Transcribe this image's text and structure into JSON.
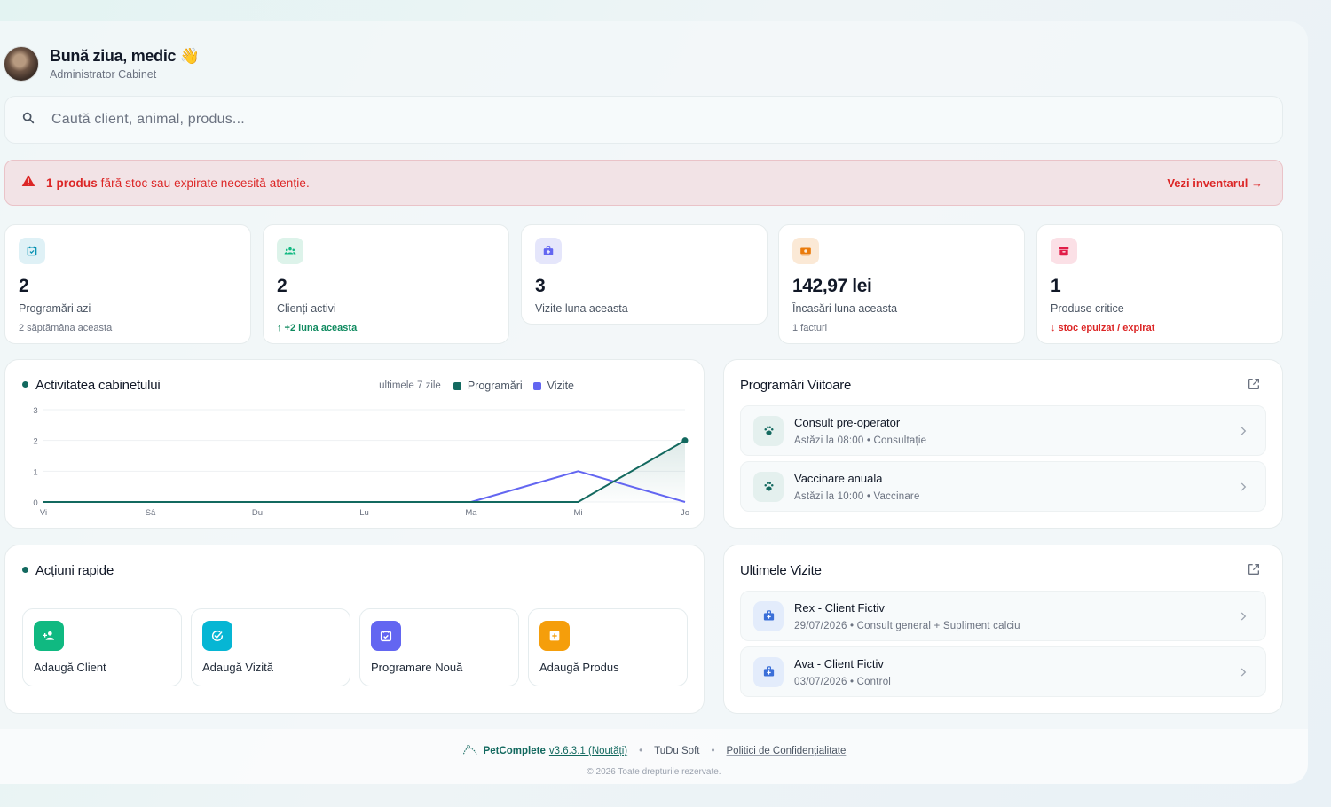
{
  "header": {
    "greeting": "Bună ziua, medic 👋",
    "role": "Administrator Cabinet"
  },
  "search": {
    "placeholder": "Caută client, animal, produs..."
  },
  "alert": {
    "count_text": "1 produs",
    "text": " fără stoc sau expirate necesită atenție.",
    "link": "Vezi inventarul →"
  },
  "stats": [
    {
      "value": "2",
      "label": "Programări azi",
      "note": "2 săptămâna aceasta",
      "icon": "calendar-check-icon",
      "color": "#0891b2"
    },
    {
      "value": "2",
      "label": "Clienți activi",
      "note": "↑ +2 luna aceasta",
      "icon": "users-icon",
      "color": "#10b981"
    },
    {
      "value": "3",
      "label": "Vizite luna aceasta",
      "note": "",
      "icon": "medical-bag-icon",
      "color": "#6366f1"
    },
    {
      "value": "142,97 lei",
      "label": "Încasări luna aceasta",
      "note": "1 facturi",
      "icon": "cash-icon",
      "color": "#ea7b0c"
    },
    {
      "value": "1",
      "label": "Produse critice",
      "note": "↓ stoc epuizat / expirat",
      "icon": "archive-icon",
      "color": "#e11d48"
    }
  ],
  "activity": {
    "title": "Activitatea cabinetului",
    "range": "ultimele 7 zile",
    "legend": [
      "Programări",
      "Vizite"
    ]
  },
  "chart_data": {
    "type": "line",
    "categories": [
      "Vi",
      "Sâ",
      "Du",
      "Lu",
      "Ma",
      "Mi",
      "Jo"
    ],
    "series": [
      {
        "name": "Programări",
        "values": [
          0,
          0,
          0,
          0,
          0,
          0,
          2
        ],
        "color": "#13695f"
      },
      {
        "name": "Vizite",
        "values": [
          0,
          0,
          0,
          0,
          0,
          1,
          0
        ],
        "color": "#6366f1"
      }
    ],
    "yticks": [
      "0",
      "1",
      "2",
      "3"
    ],
    "ylim": [
      0,
      3
    ],
    "grid": true
  },
  "upcoming": {
    "title": "Programări Viitoare",
    "items": [
      {
        "title": "Consult pre-operator",
        "sub": "Astăzi la 08:00  •  Consultație"
      },
      {
        "title": "Vaccinare anuala",
        "sub": "Astăzi la 10:00  •  Vaccinare"
      }
    ]
  },
  "quick": {
    "title": "Acțiuni rapide",
    "actions": [
      {
        "label": "Adaugă Client",
        "color": "#10b981",
        "icon": "user-plus-icon"
      },
      {
        "label": "Adaugă Vizită",
        "color": "#06b6d4",
        "icon": "check-badge-icon"
      },
      {
        "label": "Programare Nouă",
        "color": "#6366f1",
        "icon": "calendar-icon"
      },
      {
        "label": "Adaugă Produs",
        "color": "#f59e0b",
        "icon": "add-box-icon"
      }
    ]
  },
  "recent": {
    "title": "Ultimele Vizite",
    "items": [
      {
        "title": "Rex - Client Fictiv",
        "sub": "29/07/2026  •  Consult general + Supliment calciu"
      },
      {
        "title": "Ava - Client Fictiv",
        "sub": "03/07/2026  •  Control"
      }
    ]
  },
  "footer": {
    "brand": "PetComplete",
    "version": "v3.6.3.1 (Noutăți)",
    "company": "TuDu Soft",
    "policy": "Politici de Confidențialitate",
    "copyright": "© 2026 Toate drepturile rezervate."
  }
}
